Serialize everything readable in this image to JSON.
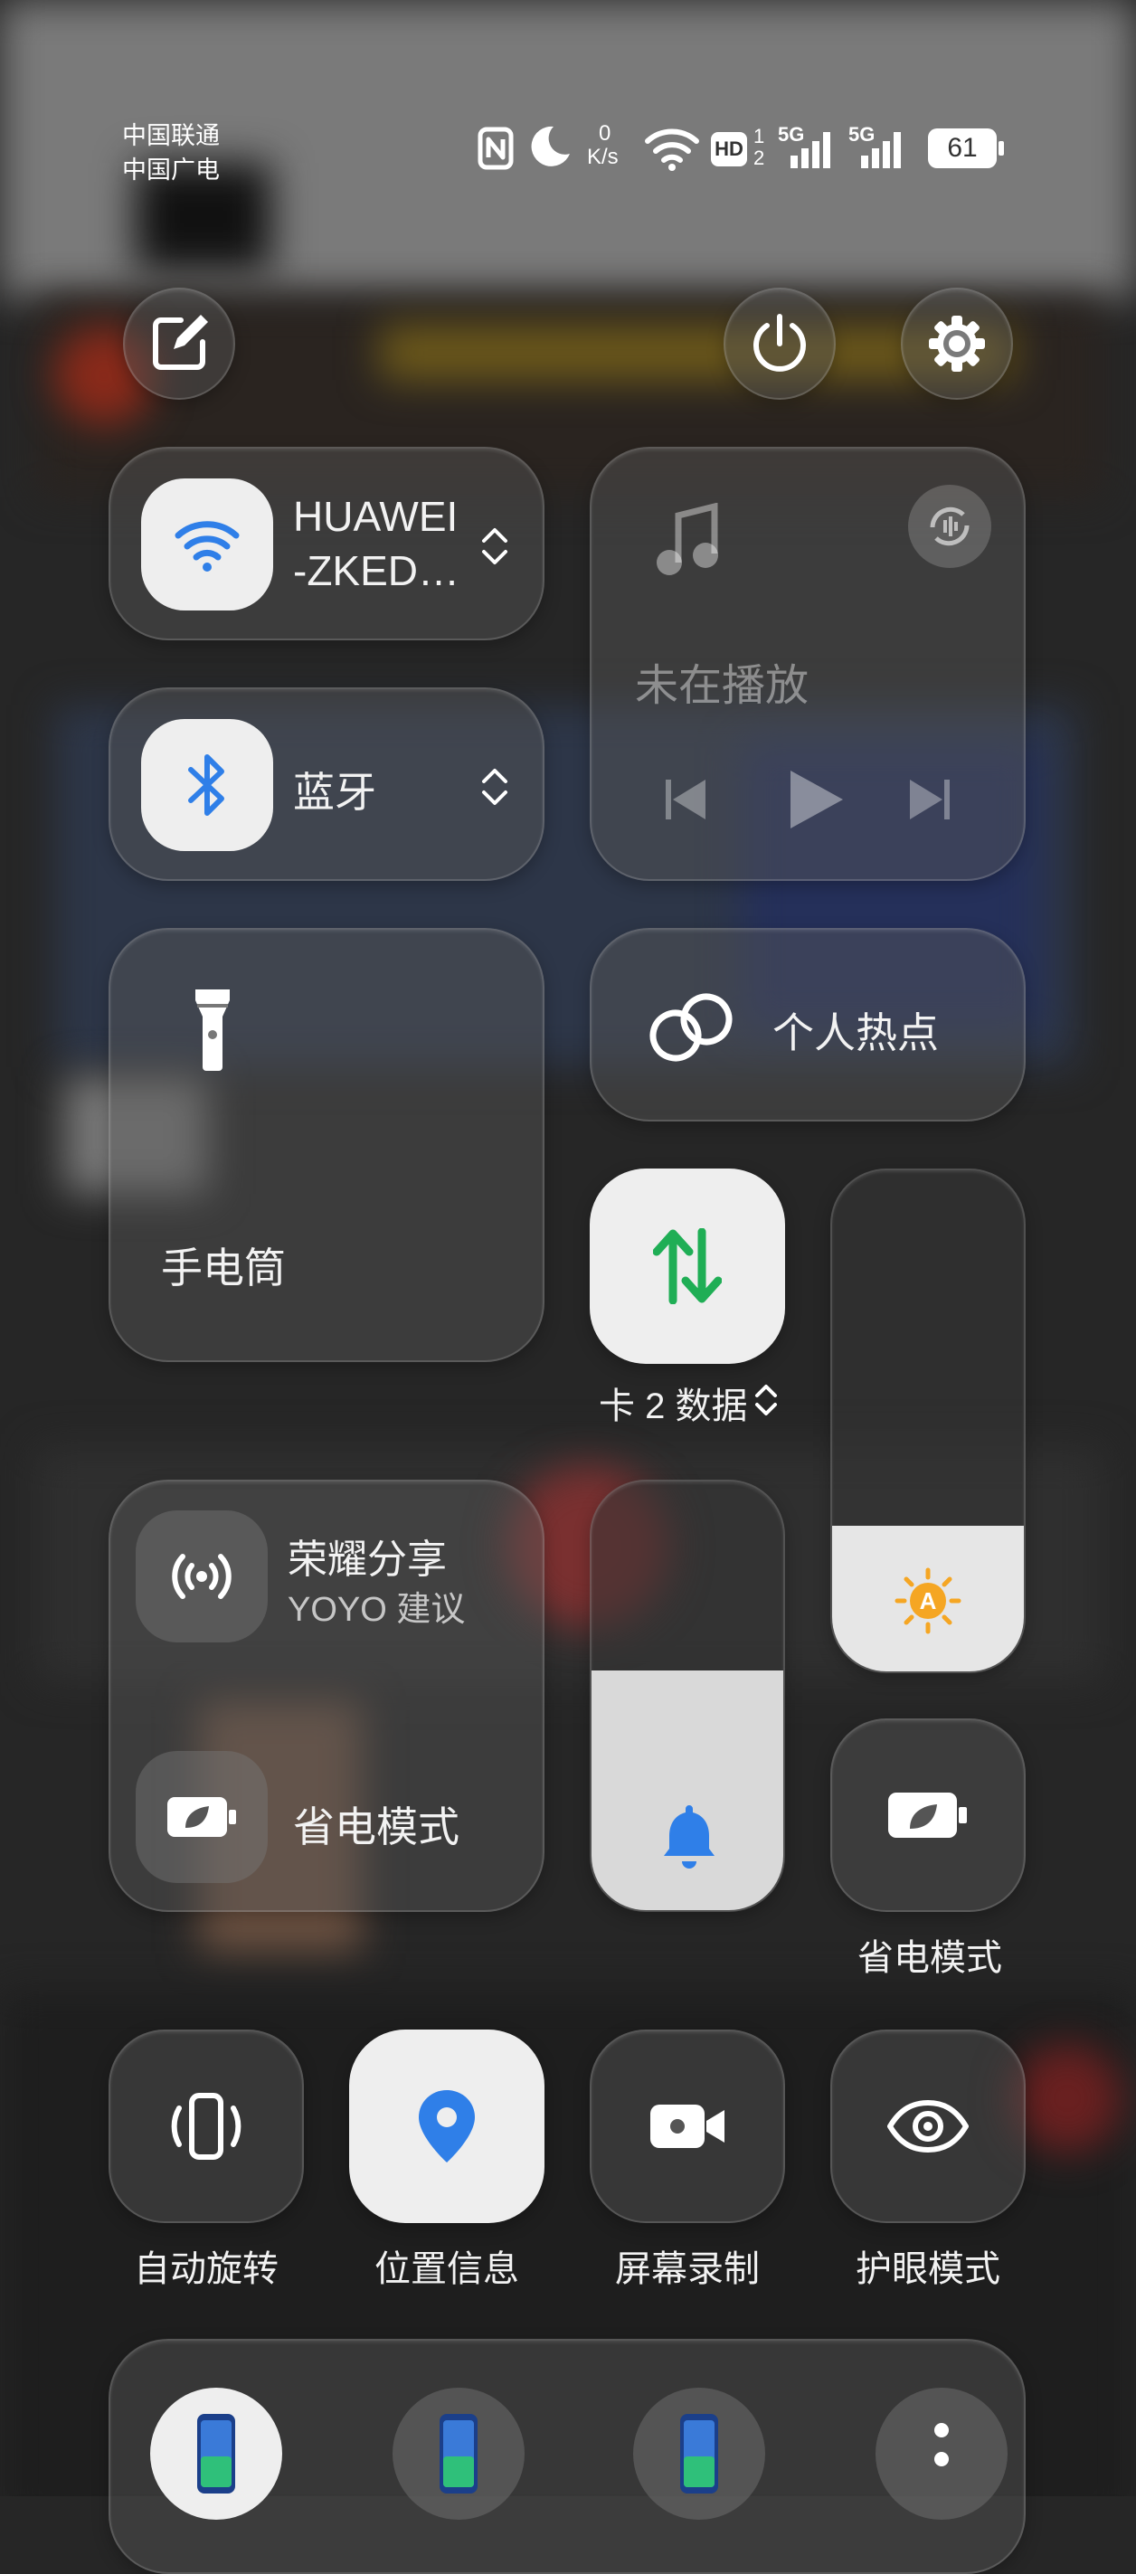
{
  "status_bar": {
    "carrier_1": "中国联通",
    "carrier_2": "中国广电",
    "net_speed_value": "0",
    "net_speed_unit": "K/s",
    "hd_badge": "HD",
    "hd_sims": [
      "1",
      "2"
    ],
    "signal_1_label": "5G",
    "signal_2_label": "5G",
    "battery": "61",
    "icons": [
      "nfc-icon",
      "do-not-disturb-moon-icon",
      "wifi-icon",
      "signal-icon",
      "battery-icon"
    ]
  },
  "top_buttons": {
    "edit": "edit-icon",
    "power": "power-icon",
    "settings": "gear-icon"
  },
  "wifi": {
    "name_line1": "HUAWEI",
    "name_line2": "-ZKED…",
    "icon": "wifi-icon"
  },
  "bluetooth": {
    "label": "蓝牙",
    "icon": "bluetooth-icon"
  },
  "media": {
    "status": "未在播放",
    "icons": [
      "music-note-icon",
      "audio-output-icon",
      "previous-icon",
      "play-icon",
      "next-icon"
    ]
  },
  "flashlight": {
    "label": "手电筒",
    "icon": "flashlight-icon"
  },
  "hotspot": {
    "label": "个人热点",
    "icon": "link-icon"
  },
  "mobile_data": {
    "label": "卡 2 数据",
    "icon": "data-arrows-icon"
  },
  "brightness_slider": {
    "level": 0.29,
    "icon": "auto-brightness-icon",
    "icon_text": "A"
  },
  "volume_slider": {
    "level": 0.56,
    "icon": "bell-icon"
  },
  "share_card": {
    "title": "荣耀分享",
    "subtitle": "YOYO 建议",
    "power_saving_label": "省电模式"
  },
  "power_saving_tile": {
    "label": "省电模式"
  },
  "tiles_row": [
    {
      "label": "自动旋转",
      "icon": "auto-rotate-icon",
      "active": false
    },
    {
      "label": "位置信息",
      "icon": "location-pin-icon",
      "active": true
    },
    {
      "label": "屏幕录制",
      "icon": "video-camera-icon",
      "active": false
    },
    {
      "label": "护眼模式",
      "icon": "eye-icon",
      "active": false
    }
  ],
  "device_bar": {
    "icons": [
      "phone-device-icon",
      "phone-device-icon",
      "phone-device-icon",
      "more-icon"
    ]
  },
  "colors": {
    "accent_blue": "#2f7fe8",
    "accent_green": "#1fae55",
    "brightness_orange": "#f5a623"
  }
}
